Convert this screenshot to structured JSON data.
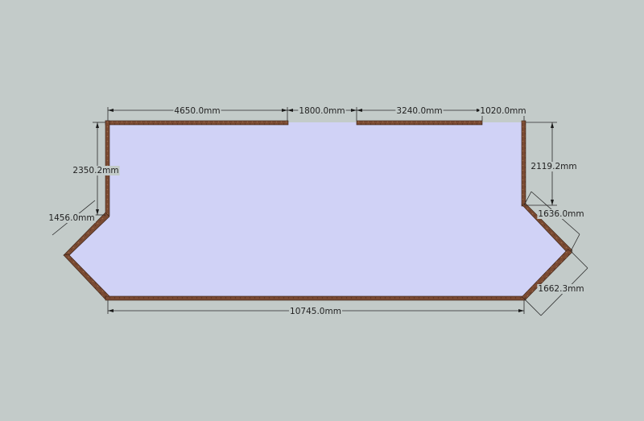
{
  "colors": {
    "background": "#c3cbc9",
    "floor": "#d0d2f6",
    "wall": "#7a4a32",
    "wall_edge": "#3a2216",
    "dimension": "#2a2a2a"
  },
  "dimensions": {
    "top_left": "4650.0mm",
    "top_door": "1800.0mm",
    "top_middle": "3240.0mm",
    "top_right": "1020.0mm",
    "left_upper": "2350.2mm",
    "left_diagonal": "1456.0mm",
    "right_upper": "2119.2mm",
    "right_diagonal_upper": "1636.0mm",
    "right_diagonal_lower": "1662.3mm",
    "bottom": "10745.0mm"
  }
}
